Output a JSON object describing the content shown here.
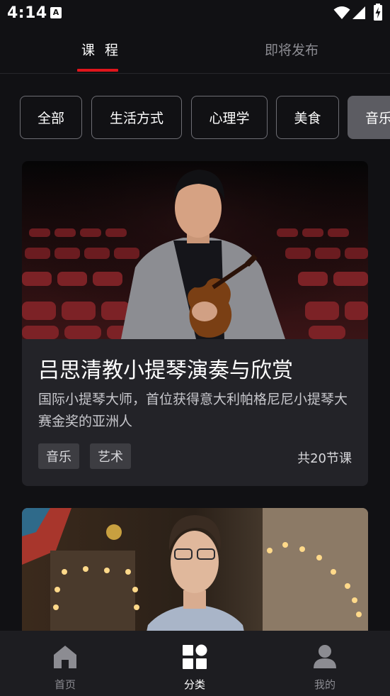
{
  "status_bar": {
    "time": "4:14",
    "notification_icon": "A",
    "icons": [
      "wifi-icon",
      "signal-icon",
      "battery-charging-icon"
    ]
  },
  "top_tabs": [
    {
      "label": "课 程",
      "active": true
    },
    {
      "label": "即将发布",
      "active": false
    }
  ],
  "categories": [
    {
      "label": "全部",
      "selected": false
    },
    {
      "label": "生活方式",
      "selected": false
    },
    {
      "label": "心理学",
      "selected": false
    },
    {
      "label": "美食",
      "selected": false
    },
    {
      "label": "音乐",
      "selected": true
    }
  ],
  "courses": [
    {
      "title": "吕思清教小提琴演奏与欣赏",
      "description": "国际小提琴大师，首位获得意大利帕格尼尼小提琴大赛金奖的亚洲人",
      "tags": [
        "音乐",
        "艺术"
      ],
      "lesson_count": "共20节课",
      "image": "man-with-violin-in-concert-hall"
    },
    {
      "title": "",
      "image": "performer-with-glasses-in-theater-dressing-room"
    }
  ],
  "bottom_nav": [
    {
      "label": "首页",
      "icon": "home-icon",
      "active": false
    },
    {
      "label": "分类",
      "icon": "grid-icon",
      "active": true
    },
    {
      "label": "我的",
      "icon": "profile-icon",
      "active": false
    }
  ],
  "colors": {
    "background": "#111114",
    "accent_red": "#e0151c",
    "card_background": "#232328",
    "nav_background": "#1d1d21",
    "inactive_text": "#8c8c92"
  }
}
